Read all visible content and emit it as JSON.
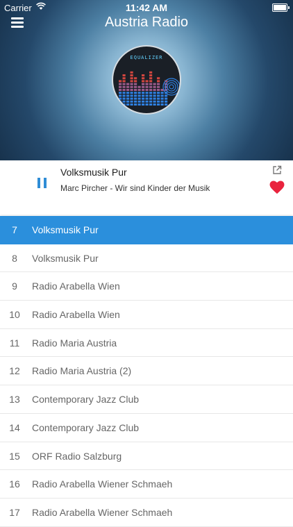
{
  "status_bar": {
    "carrier": "Carrier",
    "time": "11:42 AM"
  },
  "header": {
    "title": "Austria Radio",
    "menu_icon": "hamburger-menu-icon",
    "logo_text": "EQUALIZER"
  },
  "now_playing": {
    "station": "Volksmusik Pur",
    "track": "Marc Pircher - Wir sind Kinder der Musik",
    "play_state_icon": "pause-icon",
    "share_icon": "share-external-icon",
    "favorite_icon": "heart-icon",
    "accent_color": "#2f8dd6",
    "favorite_color": "#e9233d"
  },
  "stations": [
    {
      "number": "7",
      "name": "Volksmusik Pur",
      "active": true
    },
    {
      "number": "8",
      "name": "Volksmusik Pur"
    },
    {
      "number": "9",
      "name": "Radio Arabella Wien"
    },
    {
      "number": "10",
      "name": "Radio Arabella Wien"
    },
    {
      "number": "11",
      "name": "Radio Maria Austria"
    },
    {
      "number": "12",
      "name": "Radio Maria Austria (2)"
    },
    {
      "number": "13",
      "name": "Contemporary Jazz Club"
    },
    {
      "number": "14",
      "name": "Contemporary Jazz Club"
    },
    {
      "number": "15",
      "name": "ORF Radio Salzburg"
    },
    {
      "number": "16",
      "name": "Radio Arabella Wiener Schmaeh"
    },
    {
      "number": "17",
      "name": "Radio Arabella Wiener Schmaeh"
    }
  ],
  "selection_color": "#2b8fdc"
}
